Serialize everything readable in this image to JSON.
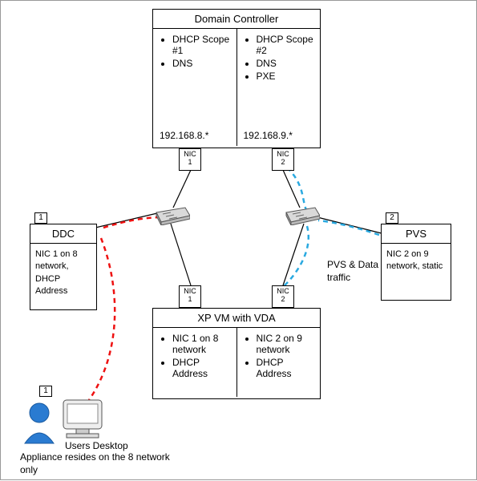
{
  "domain_controller": {
    "title": "Domain Controller",
    "col1": {
      "items": [
        "DHCP Scope #1",
        "DNS"
      ],
      "ip": "192.168.8.*"
    },
    "col2": {
      "items": [
        "DHCP Scope #2",
        "DNS",
        "PXE"
      ],
      "ip": "192.168.9.*"
    },
    "nic1": "NIC 1",
    "nic2": "NIC 2"
  },
  "ddc": {
    "tab": "1",
    "title": "DDC",
    "body": "NIC 1 on 8 network, DHCP Address"
  },
  "pvs": {
    "tab": "2",
    "title": "PVS",
    "body": "NIC 2 on 9 network, static"
  },
  "xpvm": {
    "title": "XP VM with VDA",
    "col1_items": [
      "NIC 1 on 8 network",
      "DHCP Address"
    ],
    "col2_items": [
      "NIC 2 on 9 network",
      "DHCP Address"
    ],
    "nic1": "NIC 1",
    "nic2": "NIC 2"
  },
  "labels": {
    "pvs_traffic": "PVS & Data traffic",
    "user_desktop": "Users Desktop",
    "appliance_note": "Appliance resides on the 8 network only",
    "client_tab": "1"
  },
  "icons": {
    "switch_left": "network-switch-icon",
    "switch_right": "network-switch-icon",
    "user": "user-icon",
    "monitor": "monitor-icon"
  }
}
